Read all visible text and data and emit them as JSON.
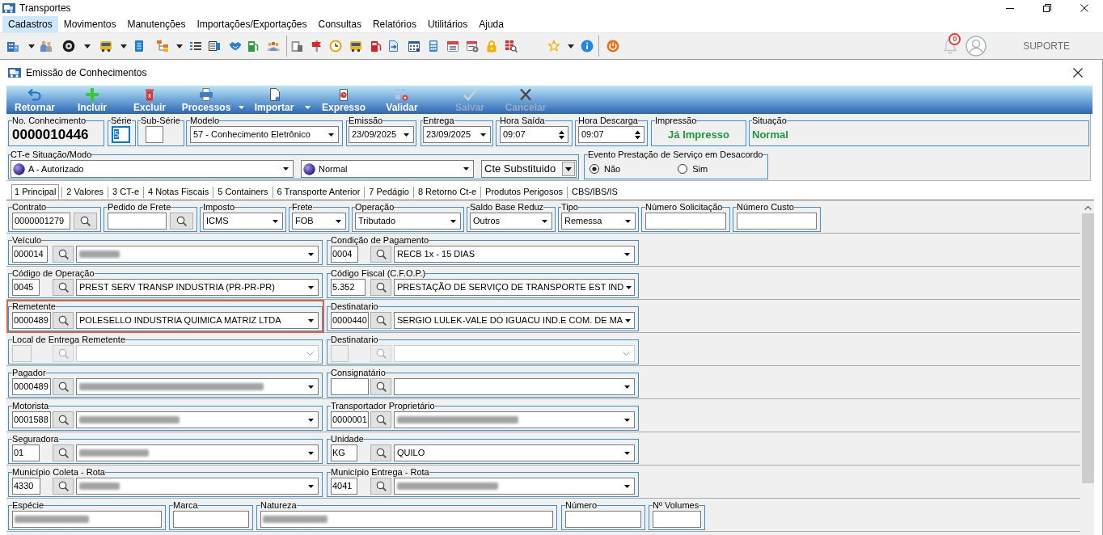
{
  "app": {
    "title": "Transportes"
  },
  "menu": [
    {
      "label": "Cadastros",
      "selected": true
    },
    {
      "label": "Movimentos",
      "selected": false
    },
    {
      "label": "Manutenções",
      "selected": false
    },
    {
      "label": "Importações/Exportações",
      "selected": false
    },
    {
      "label": "Consultas",
      "selected": false
    },
    {
      "label": "Relatórios",
      "selected": false
    },
    {
      "label": "Utilitários",
      "selected": false
    },
    {
      "label": "Ajuda",
      "selected": false
    }
  ],
  "toolbar": {
    "notification_count": "0",
    "user": "SUPORTE"
  },
  "window": {
    "title": "Emissão de Conhecimentos"
  },
  "actions": [
    {
      "label": "Retornar",
      "disabled": false,
      "dropdown": false
    },
    {
      "label": "Incluir",
      "disabled": false,
      "dropdown": false
    },
    {
      "label": "Excluir",
      "disabled": false,
      "dropdown": false
    },
    {
      "label": "Processos",
      "disabled": false,
      "dropdown": true
    },
    {
      "label": "Importar",
      "disabled": false,
      "dropdown": true
    },
    {
      "label": "Expresso",
      "disabled": false,
      "dropdown": false
    },
    {
      "label": "Validar",
      "disabled": false,
      "dropdown": false
    },
    {
      "label": "Salvar",
      "disabled": true,
      "dropdown": false
    },
    {
      "label": "Cancelar",
      "disabled": true,
      "dropdown": false
    }
  ],
  "header": [
    {
      "label": "No. Conhecimento",
      "kind": "display",
      "value": "0000010446"
    },
    {
      "label": "Série",
      "kind": "input",
      "value": "5",
      "focused": true
    },
    {
      "label": "Sub-Série",
      "kind": "input",
      "focused": false
    },
    {
      "label": "Modelo",
      "kind": "select",
      "value": "57 - Conhecimento Eletrônico"
    },
    {
      "label": "Emissão",
      "kind": "select",
      "value": "23/09/2025"
    },
    {
      "label": "Entrega",
      "kind": "select",
      "value": "23/09/2025"
    },
    {
      "label": "Hora Saída",
      "kind": "spinner",
      "value": "09:07"
    },
    {
      "label": "Hora Descarga",
      "kind": "spinner",
      "value": "09:07"
    },
    {
      "label": "Impressão",
      "kind": "status",
      "value": "Já Impresso"
    },
    {
      "label": "Situação",
      "kind": "status",
      "value": "Normal"
    }
  ],
  "cte": {
    "label": "CT-e Situação/Modo",
    "selects": [
      {
        "kind": "dot",
        "value": "A - Autorizado"
      },
      {
        "kind": "dot",
        "value": "Normal"
      },
      {
        "kind": "plain",
        "value": "Cte Substituido"
      }
    ]
  },
  "desacordo": {
    "label": "Evento Prestação de Serviço em Desacordo",
    "options": [
      {
        "label": "Não",
        "selected": true
      },
      {
        "label": "Sim",
        "selected": false
      }
    ]
  },
  "tabs": [
    {
      "label": "1 Principal",
      "selected": true
    },
    {
      "label": "2 Valores",
      "selected": false
    },
    {
      "label": "3 CT-e",
      "selected": false
    },
    {
      "label": "4 Notas Fiscais",
      "selected": false
    },
    {
      "label": "5 Containers",
      "selected": false
    },
    {
      "label": "6 Transporte Anterior",
      "selected": false
    },
    {
      "label": "7 Pedágio",
      "selected": false
    },
    {
      "label": "8 Retorno Ct-e",
      "selected": false
    },
    {
      "label": "Produtos Perigosos",
      "selected": false
    },
    {
      "label": "CBS/IBS/IS",
      "selected": false
    }
  ],
  "form_rows": [
    {
      "fields": [
        {
          "label": "Contrato",
          "kind": "lookup",
          "value": "0000001279"
        },
        {
          "label": "Pedido de Frete",
          "kind": "lookup"
        },
        {
          "label": "Imposto",
          "kind": "select",
          "value": "ICMS"
        },
        {
          "label": "Frete",
          "kind": "select",
          "value": "FOB"
        },
        {
          "label": "Operação",
          "kind": "select",
          "value": "Tributado"
        },
        {
          "label": "Saldo Base Reduz",
          "kind": "select",
          "value": "Outros"
        },
        {
          "label": "Tipo",
          "kind": "select",
          "value": "Remessa"
        },
        {
          "label": "Número Solicitação",
          "kind": "input"
        },
        {
          "label": "Número Custo",
          "kind": "input"
        }
      ]
    },
    {
      "fields": [
        {
          "label": "Veículo",
          "kind": "code_lookup",
          "code": "000014",
          "redacted": true,
          "disabled": false,
          "highlighted": false
        },
        {
          "label": "Condição de Pagamento",
          "kind": "code_lookup",
          "code": "0004",
          "value": "RECB 1x - 15 DIAS",
          "redacted": false,
          "disabled": false,
          "highlighted": false
        }
      ]
    },
    {
      "fields": [
        {
          "label": "Código de Operação",
          "kind": "code_lookup",
          "code": "0045",
          "value": "PREST SERV TRANSP INDUSTRIA (PR-PR-PR)",
          "redacted": false,
          "disabled": false,
          "highlighted": false
        },
        {
          "label": "Código Fiscal (C.F.O.P.)",
          "kind": "code_lookup",
          "code": "5.352",
          "value": "PRESTAÇÃO DE SERVIÇO DE TRANSPORTE EST IND",
          "redacted": false,
          "disabled": false,
          "highlighted": false
        }
      ]
    },
    {
      "fields": [
        {
          "label": "Remetente",
          "kind": "code_lookup",
          "code": "0000489",
          "value": "POLESELLO INDUSTRIA QUIMICA MATRIZ LTDA",
          "redacted": false,
          "disabled": false,
          "highlighted": true
        },
        {
          "label": "Destinatario",
          "kind": "code_lookup",
          "code": "0000440",
          "value": "SERGIO LULEK-VALE DO IGUACU IND.E COM. DE MA",
          "redacted": false,
          "disabled": false,
          "highlighted": false
        }
      ]
    },
    {
      "fields": [
        {
          "label": "Local de Entrega Remetente",
          "kind": "code_lookup",
          "redacted": false,
          "disabled": true,
          "highlighted": false
        },
        {
          "label": "Destinatario",
          "kind": "code_lookup",
          "redacted": false,
          "disabled": true,
          "highlighted": false
        }
      ]
    },
    {
      "fields": [
        {
          "label": "Pagador",
          "kind": "code_lookup",
          "code": "0000489",
          "redacted": true,
          "disabled": false,
          "highlighted": false
        },
        {
          "label": "Consignatário",
          "kind": "code_lookup",
          "redacted": false,
          "disabled": false,
          "highlighted": false
        }
      ]
    },
    {
      "fields": [
        {
          "label": "Motorista",
          "kind": "code_lookup",
          "code": "0001588",
          "redacted": true,
          "disabled": false,
          "highlighted": false
        },
        {
          "label": "Transportador Proprietário",
          "kind": "code_lookup",
          "code": "0000001",
          "redacted": true,
          "disabled": false,
          "highlighted": false
        }
      ]
    },
    {
      "fields": [
        {
          "label": "Seguradora",
          "kind": "code_lookup",
          "code": "01",
          "redacted": true,
          "disabled": false,
          "highlighted": false
        },
        {
          "label": "Unidade",
          "kind": "code_lookup",
          "code": "KG",
          "value": "QUILO",
          "redacted": false,
          "disabled": false,
          "highlighted": false
        }
      ]
    },
    {
      "fields": [
        {
          "label": "Município Coleta - Rota",
          "kind": "code_lookup",
          "code": "4330",
          "redacted": true,
          "disabled": false,
          "highlighted": false
        },
        {
          "label": "Município Entrega - Rota",
          "kind": "code_lookup",
          "code": "4041",
          "redacted": true,
          "disabled": false,
          "highlighted": false
        }
      ]
    },
    {
      "fields": [
        {
          "label": "Espécie",
          "kind": "input",
          "redacted": true
        },
        {
          "label": "Marca",
          "kind": "input",
          "redacted": false
        },
        {
          "label": "Natureza",
          "kind": "input",
          "redacted": true
        },
        {
          "label": "Número",
          "kind": "input",
          "redacted": false
        },
        {
          "label": "Nº Volumes",
          "kind": "input",
          "redacted": false
        }
      ]
    }
  ]
}
